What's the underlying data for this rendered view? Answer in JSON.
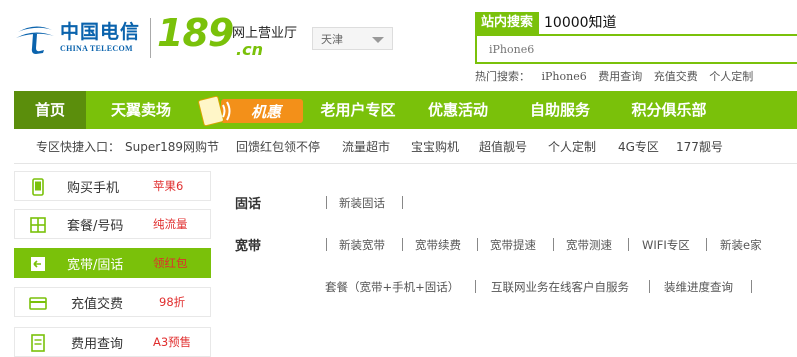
{
  "brand": {
    "cn_name": "中国电信",
    "en_name": "CHINA TELECOM",
    "number": "189",
    "subtitle": "网上营业厅",
    "domain": ".cn"
  },
  "city": {
    "selected": "天津"
  },
  "search": {
    "tab_active": "站内搜索",
    "tab_other": "10000知道",
    "placeholder": "iPhone6",
    "hot_label": "热门搜索：",
    "hot_items": [
      "iPhone6",
      "费用查询",
      "充值交费",
      "个人定制"
    ]
  },
  "nav": {
    "items": [
      "首页",
      "天翼卖场",
      "机惠",
      "老用户专区",
      "优惠活动",
      "自助服务",
      "积分俱乐部"
    ]
  },
  "shortcuts": {
    "label": "专区快捷入口：",
    "items": [
      "Super189网购节",
      "回馈红包领不停",
      "流量超市",
      "宝宝购机",
      "超值靓号",
      "个人定制",
      "4G专区",
      "177靓号"
    ]
  },
  "sidebar": {
    "items": [
      {
        "label": "购买手机",
        "tag": "苹果6",
        "icon": "phone-icon"
      },
      {
        "label": "套餐/号码",
        "tag": "纯流量",
        "icon": "package-icon"
      },
      {
        "label": "宽带/固话",
        "tag": "领红包",
        "icon": "broadband-icon"
      },
      {
        "label": "充值交费",
        "tag": "98折",
        "icon": "card-icon"
      },
      {
        "label": "费用查询",
        "tag": "A3预售",
        "icon": "bill-icon"
      }
    ]
  },
  "content": {
    "fixed_line": {
      "label": "固话",
      "links": [
        "新装固话"
      ]
    },
    "broadband": {
      "label": "宽带",
      "links_row1": [
        "新装宽带",
        "宽带续费",
        "宽带提速",
        "宽带测速",
        "WIFI专区",
        "新装e家"
      ],
      "links_row2": [
        "套餐（宽带+手机+固话）",
        "互联网业务在线客户自服务",
        "装维进度查询"
      ]
    }
  },
  "colors": {
    "brand_green": "#7ac10a",
    "active_green": "#5b8e0c",
    "brand_blue": "#0a63ad",
    "tag_red": "#e02e2e",
    "promo_orange": "#f39019"
  }
}
